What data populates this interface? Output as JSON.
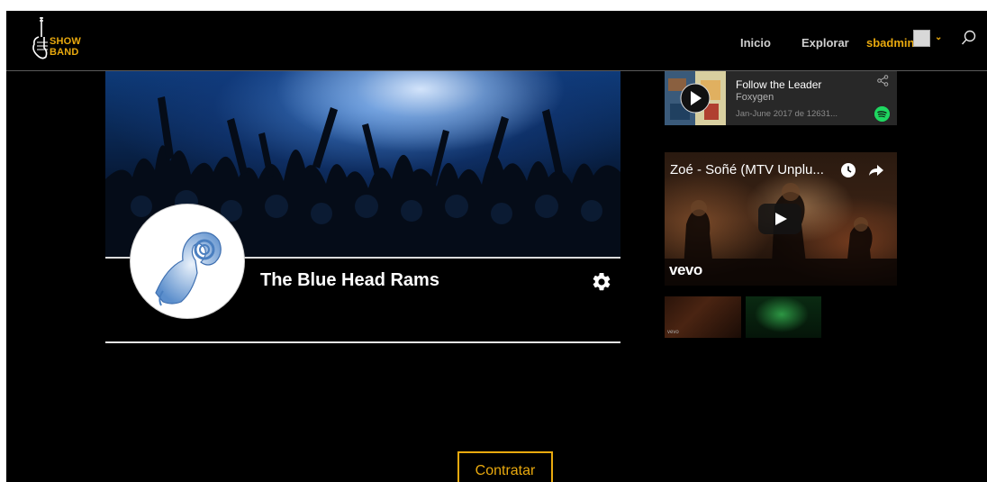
{
  "nav": {
    "logo_line1": "SHOW",
    "logo_line2": "BAND",
    "inicio": "Inicio",
    "explorar": "Explorar",
    "user": "sbadmin"
  },
  "profile": {
    "band_name": "The Blue Head Rams",
    "hire_button": "Contratar"
  },
  "spotify": {
    "track": "Follow the Leader",
    "artist": "Foxygen",
    "playlist": "Jan-June 2017 de 12631..."
  },
  "video": {
    "title": "Zoé - Soñé (MTV Unplu...",
    "brand": "vevo",
    "thumb_brand": "vevo"
  },
  "colors": {
    "accent": "#e9a90e",
    "spotify_green": "#1ed760",
    "background": "#000000"
  },
  "icons": [
    "guitar-logo-icon",
    "search-icon",
    "chevron-down-icon",
    "gear-icon",
    "play-icon",
    "share-icon",
    "spotify-icon",
    "clock-icon",
    "forward-share-icon"
  ]
}
